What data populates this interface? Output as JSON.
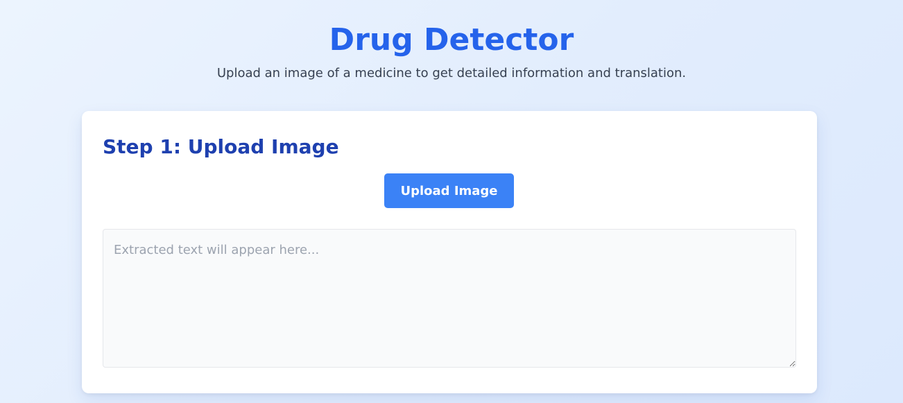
{
  "header": {
    "title": "Drug Detector",
    "subtitle": "Upload an image of a medicine to get detailed information and translation."
  },
  "step1": {
    "title": "Step 1: Upload Image",
    "upload_button_label": "Upload Image",
    "textarea_placeholder": "Extracted text will appear here...",
    "textarea_value": ""
  },
  "colors": {
    "title": "#2563eb",
    "step_title": "#1e40af",
    "button": "#3b82f6",
    "card_bg": "#ffffff",
    "textarea_bg": "#f9fafb"
  }
}
